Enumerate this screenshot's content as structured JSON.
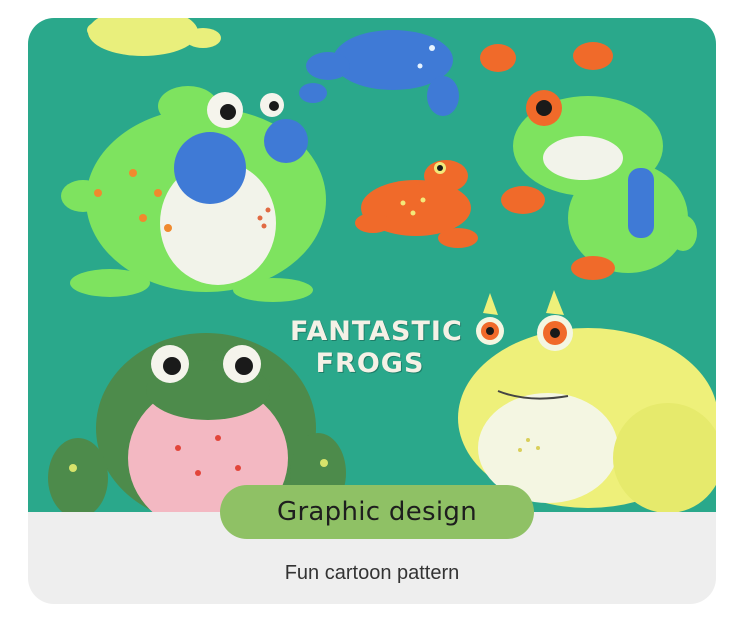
{
  "photo": {
    "print_line1": "FANTASTIC",
    "print_line2": "FROGS",
    "background_color": "#2aa88b"
  },
  "badge": {
    "label": "Graphic design",
    "color": "#8fc165"
  },
  "caption": "Fun cartoon pattern"
}
